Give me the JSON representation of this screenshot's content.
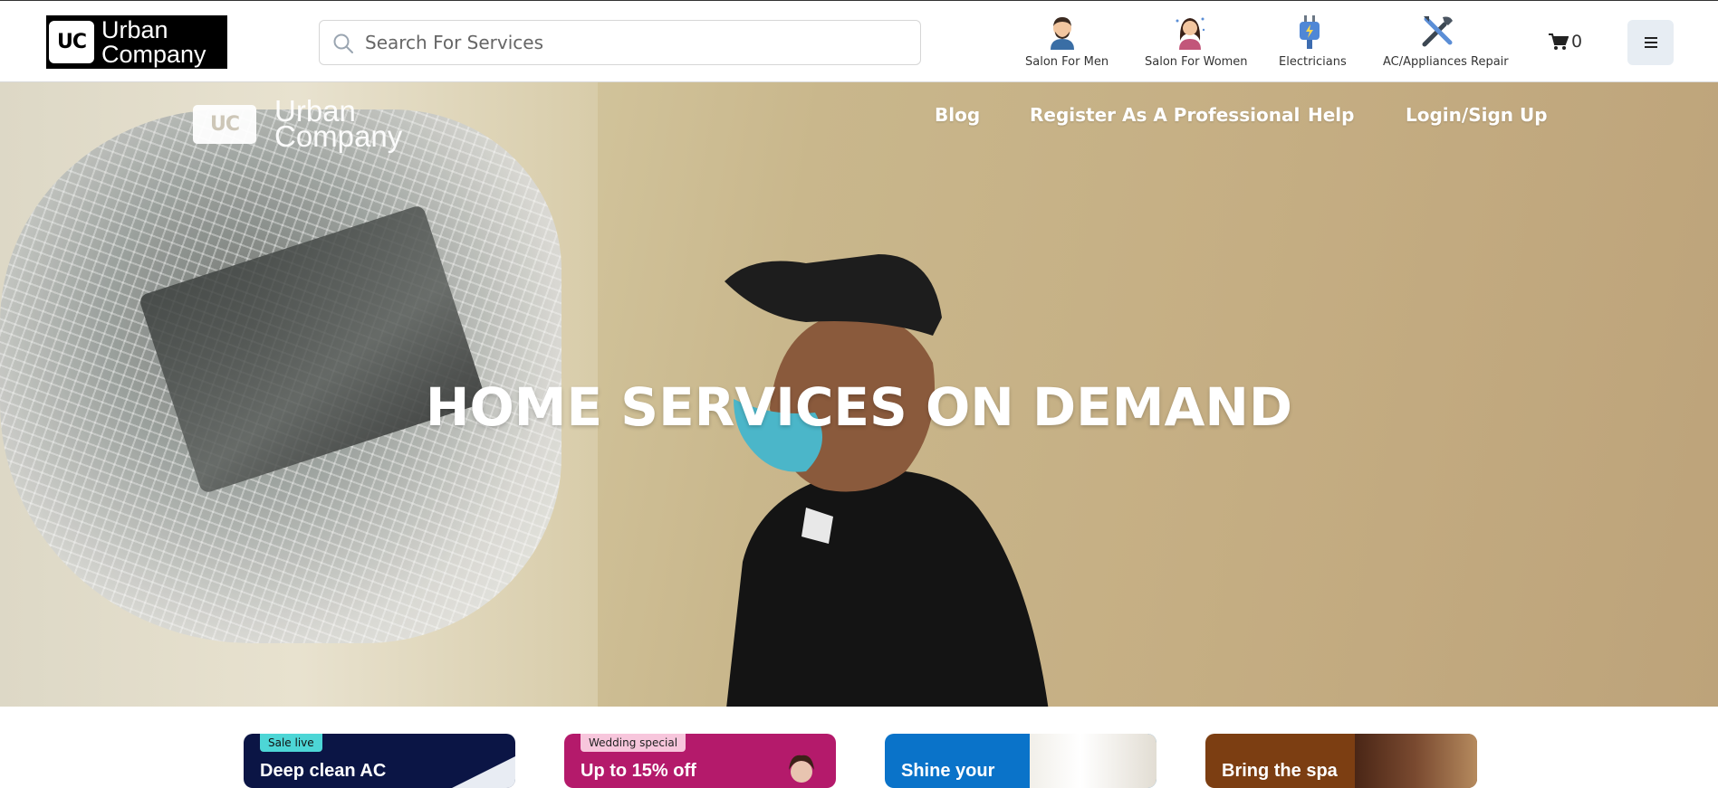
{
  "brand": {
    "logo_mark": "UC",
    "name_line1": "Urban",
    "name_line2": "Company"
  },
  "search": {
    "placeholder": "Search For Services",
    "icon": "search-icon"
  },
  "categories": [
    {
      "label": "Salon For Men",
      "icon": "man-avatar-icon"
    },
    {
      "label": "Salon For Women",
      "icon": "woman-avatar-icon"
    },
    {
      "label": "Electricians",
      "icon": "plug-icon"
    },
    {
      "label": "AC/Appliances Repair",
      "icon": "tools-icon"
    }
  ],
  "cart": {
    "icon": "cart-icon",
    "count": "0"
  },
  "menu": {
    "icon": "hamburger-menu-icon"
  },
  "hero": {
    "logo_mark": "UC",
    "logo_text_1": "Urban",
    "logo_text_2": "Company",
    "nav": [
      "Blog",
      "Register As A Professional",
      "Help",
      "Login/Sign Up"
    ],
    "title": "HOME SERVICES ON DEMAND"
  },
  "promo_cards": [
    {
      "badge": "Sale live",
      "title": "Deep clean AC",
      "bg": "#0b1545",
      "badge_bg": "#4dd6d6",
      "badge_color": "#111111"
    },
    {
      "badge": "Wedding special",
      "title": "Up to 15% off",
      "bg": "#b41a6b",
      "badge_bg": "#f7c6dc",
      "badge_color": "#222222"
    },
    {
      "badge": "",
      "title": "Shine your",
      "bg": "#0a73c9"
    },
    {
      "badge": "",
      "title": "Bring the spa",
      "bg": "#7c3e12"
    }
  ],
  "colors": {
    "accent_dark": "#000000",
    "menu_bg": "#e7edf3"
  }
}
